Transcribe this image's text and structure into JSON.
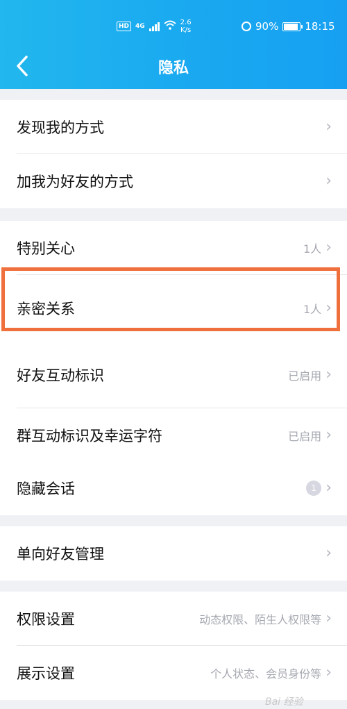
{
  "status_bar": {
    "hd": "HD",
    "network": "4G",
    "speed_value": "2.6",
    "speed_unit": "K/s",
    "battery": "90%",
    "time": "18:15"
  },
  "header": {
    "title": "隐私"
  },
  "groups": [
    {
      "items": [
        {
          "label": "发现我的方式",
          "value": ""
        },
        {
          "label": "加我为好友的方式",
          "value": ""
        }
      ]
    },
    {
      "items": [
        {
          "label": "特别关心",
          "value": "1人"
        },
        {
          "label": "亲密关系",
          "value": "1人"
        },
        {
          "label": "好友互动标识",
          "value": "已启用"
        },
        {
          "label": "群互动标识及幸运字符",
          "value": "已启用"
        }
      ]
    },
    {
      "items": [
        {
          "label": "隐藏会话",
          "badge": "1"
        }
      ]
    },
    {
      "items": [
        {
          "label": "单向好友管理",
          "value": ""
        }
      ]
    },
    {
      "items": [
        {
          "label": "权限设置",
          "value": "动态权限、陌生人权限等"
        },
        {
          "label": "展示设置",
          "value": "个人状态、会员身份等"
        }
      ]
    }
  ],
  "icons": {
    "back": "back-arrow-icon",
    "chevron": "chevron-right-icon"
  },
  "colors": {
    "header": "#1aaaf0",
    "highlight": "#ef6f3d",
    "background": "#f0f1f5"
  },
  "watermark": "Bai 经验"
}
